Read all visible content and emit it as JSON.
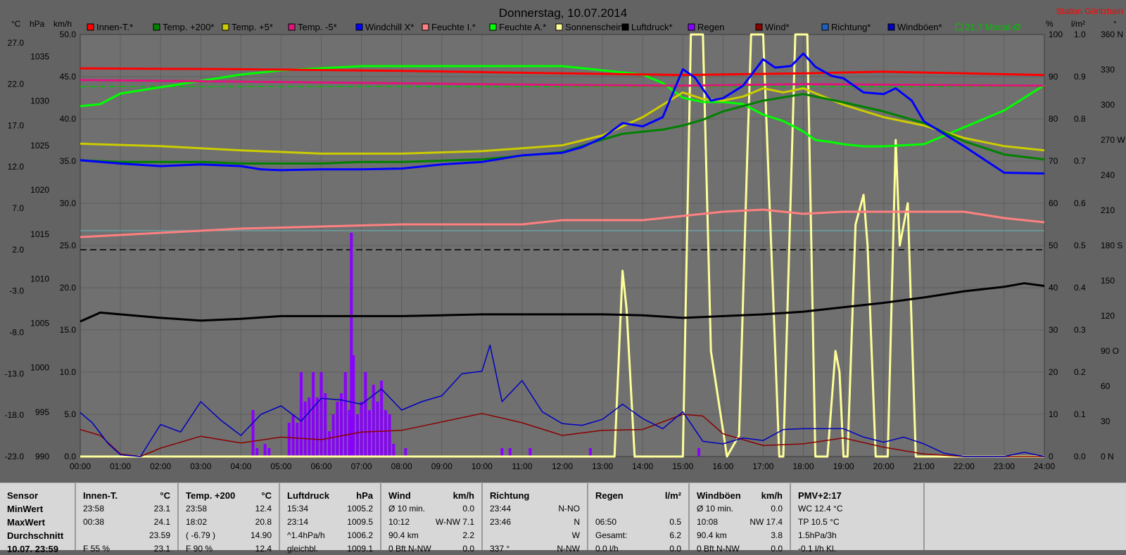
{
  "title": "Donnerstag, 10.07.2014",
  "station": "Station Göritzhain",
  "legend": [
    {
      "name": "Innen-T.*",
      "color": "#ff0000"
    },
    {
      "name": "Temp. +200*",
      "color": "#008000"
    },
    {
      "name": "Temp. +5*",
      "color": "#cccc00"
    },
    {
      "name": "Temp. -5*",
      "color": "#e0157b"
    },
    {
      "name": "Windchill X*",
      "color": "#0000ff"
    },
    {
      "name": "Feuchte I.*",
      "color": "#ff8080"
    },
    {
      "name": "Feuchte A.*",
      "color": "#00ff00"
    },
    {
      "name": "Sonnenschein",
      "color": "#ffff99"
    },
    {
      "name": "Luftdruck*",
      "color": "#000000"
    },
    {
      "name": "Regen",
      "color": "#8a00ff"
    },
    {
      "name": "Wind*",
      "color": "#8b0000"
    },
    {
      "name": "Richtung*",
      "color": "#1f5fbf"
    },
    {
      "name": "Windböen*",
      "color": "#0000c0"
    },
    {
      "name": "21.7 Monat-Ø",
      "color": "#00c000"
    }
  ],
  "axis_units": {
    "temp": "°C",
    "pressure": "hPa",
    "wind": "km/h",
    "humidity": "%",
    "rain": "l/m²",
    "dir": "°"
  },
  "chart_data": {
    "type": "line",
    "x_label": "time",
    "x_ticks": [
      "00:00",
      "01:00",
      "02:00",
      "03:00",
      "04:00",
      "05:00",
      "06:00",
      "07:00",
      "08:00",
      "09:00",
      "10:00",
      "11:00",
      "12:00",
      "13:00",
      "14:00",
      "15:00",
      "16:00",
      "17:00",
      "18:00",
      "19:00",
      "20:00",
      "21:00",
      "22:00",
      "23:00",
      "24:00"
    ],
    "axes": {
      "temp": {
        "ticks": [
          "27.0",
          "22.0",
          "17.0",
          "12.0",
          "7.0",
          "2.0",
          "-3.0",
          "-8.0",
          "-13.0",
          "-18.0",
          "-23.0"
        ],
        "range": [
          -23,
          28
        ]
      },
      "pressure": {
        "ticks": [
          "1035",
          "1030",
          "1025",
          "1020",
          "1015",
          "1010",
          "1005",
          "1000",
          "995",
          "990"
        ],
        "range": [
          990,
          1037.5
        ]
      },
      "wind": {
        "ticks": [
          "50.0",
          "45.0",
          "40.0",
          "35.0",
          "30.0",
          "25.0",
          "20.0",
          "15.0",
          "10.0",
          "5.0",
          "0.0"
        ],
        "range": [
          0,
          50
        ]
      },
      "humidity": {
        "ticks": [
          "100",
          "90",
          "80",
          "70",
          "60",
          "50",
          "40",
          "30",
          "20",
          "10",
          "0"
        ],
        "range": [
          0,
          100
        ]
      },
      "rain": {
        "ticks": [
          "1.0",
          "0.9",
          "0.8",
          "0.7",
          "0.6",
          "0.5",
          "0.4",
          "0.3",
          "0.2",
          "0.1",
          "0.0"
        ],
        "range": [
          0,
          1
        ]
      },
      "dir": {
        "ticks": [
          "360 N",
          "330",
          "300",
          "270 W",
          "240",
          "210",
          "180 S",
          "150",
          "120",
          "90 O",
          "60",
          "30",
          "0 N"
        ],
        "range": [
          0,
          360
        ]
      }
    },
    "grid": true,
    "series": [
      {
        "name": "Innen-T.*",
        "axis": "temp",
        "color": "#ff0000",
        "x": [
          0,
          4,
          8,
          12,
          15,
          18,
          20,
          22,
          24
        ],
        "y": [
          23.9,
          23.8,
          23.6,
          23.3,
          23.1,
          23.3,
          23.5,
          23.3,
          23.1
        ]
      },
      {
        "name": "Temp. +200*",
        "axis": "temp",
        "color": "#008000",
        "x": [
          0,
          1,
          3,
          4,
          5,
          6,
          7,
          8,
          10,
          12,
          12.8,
          13.5,
          14.5,
          15,
          15.5,
          16,
          17,
          18,
          19,
          20,
          21,
          22,
          23,
          24
        ],
        "y": [
          12.8,
          12.6,
          12.6,
          12.4,
          12.4,
          12.4,
          12.6,
          12.6,
          12.9,
          13.8,
          15,
          16,
          16.5,
          17,
          17.7,
          18.7,
          20,
          20.8,
          19.8,
          18.7,
          17.3,
          15.1,
          13.5,
          12.9
        ]
      },
      {
        "name": "Temp. +5*",
        "axis": "temp",
        "color": "#cccc00",
        "x": [
          0,
          2,
          4,
          6,
          8,
          10,
          12,
          13,
          14,
          15,
          15.5,
          16,
          16.5,
          17,
          17.5,
          18,
          19,
          20,
          21,
          22,
          23,
          24
        ],
        "y": [
          14.8,
          14.5,
          14,
          13.6,
          13.6,
          13.9,
          14.6,
          15.8,
          18,
          21,
          20.2,
          20,
          20.5,
          21.5,
          21,
          21.5,
          19.5,
          18,
          17,
          15.5,
          14.5,
          14
        ]
      },
      {
        "name": "Temp. -5*",
        "axis": "temp",
        "color": "#e0157b",
        "x": [
          0,
          6,
          12,
          15,
          18,
          21,
          24
        ],
        "y": [
          22.5,
          22.2,
          21.9,
          21.8,
          22,
          21.9,
          21.8
        ]
      },
      {
        "name": "Windchill X*",
        "axis": "temp",
        "color": "#0000ff",
        "x": [
          0,
          1,
          2,
          3,
          4,
          4.5,
          5,
          6,
          7,
          8,
          9,
          10,
          11,
          12,
          12.5,
          13,
          13.5,
          14,
          14.5,
          15,
          15.3,
          15.7,
          16,
          16.5,
          17,
          17.3,
          17.7,
          18,
          18.3,
          18.7,
          19,
          19.5,
          20,
          20.3,
          20.7,
          21,
          22,
          23,
          24
        ],
        "y": [
          12.8,
          12.4,
          12.1,
          12.3,
          12.1,
          11.7,
          11.6,
          11.7,
          11.7,
          11.8,
          12.3,
          12.6,
          13.4,
          13.7,
          14.4,
          15.5,
          17.3,
          16.9,
          18,
          23.8,
          22.8,
          20,
          20.3,
          21.8,
          25,
          24,
          24.2,
          25.7,
          24.1,
          23,
          22.7,
          21,
          20.8,
          21.5,
          20,
          17.5,
          14.5,
          11.3,
          11.2
        ]
      },
      {
        "name": "Feuchte I.*",
        "axis": "humidity",
        "color": "#ff8080",
        "x": [
          0,
          2,
          4,
          6,
          8,
          11,
          12,
          14,
          15,
          16,
          17,
          18,
          19,
          20,
          21,
          22,
          23,
          24
        ],
        "y": [
          52,
          53,
          54,
          54.5,
          55,
          55,
          56,
          56,
          57,
          58,
          58.5,
          57.5,
          58,
          58,
          58,
          58,
          56.5,
          55.5
        ]
      },
      {
        "name": "Feuchte A.*",
        "axis": "humidity",
        "color": "#00ff00",
        "x": [
          0,
          0.5,
          1,
          2,
          3,
          4,
          5,
          6,
          7,
          8,
          9,
          10,
          11,
          12,
          13,
          14,
          14.5,
          15,
          15.5,
          16,
          16.5,
          17,
          17.5,
          18,
          18.3,
          18.7,
          19,
          19.5,
          20,
          21,
          22,
          23,
          24
        ],
        "y": [
          83,
          83.5,
          86,
          87.5,
          89,
          90.5,
          91.5,
          92,
          92.5,
          92.5,
          92.5,
          92.5,
          92.5,
          92.5,
          91.5,
          90.5,
          88.5,
          85,
          84,
          84,
          83.5,
          81,
          79.5,
          77,
          75,
          74.5,
          74,
          73.5,
          73.5,
          74,
          78,
          82,
          88
        ]
      },
      {
        "name": "Luftdruck*",
        "axis": "pressure",
        "color": "#000000",
        "x": [
          0,
          0.5,
          1,
          2,
          3,
          4,
          5,
          6,
          7,
          8,
          9,
          10,
          11,
          12,
          13,
          14,
          15,
          16,
          17,
          18,
          19,
          20,
          21,
          22,
          23,
          23.5,
          24
        ],
        "y": [
          1005.2,
          1006.2,
          1006,
          1005.6,
          1005.3,
          1005.5,
          1005.8,
          1005.8,
          1005.8,
          1005.8,
          1005.9,
          1006,
          1006,
          1006,
          1006,
          1005.9,
          1005.6,
          1005.8,
          1006,
          1006.3,
          1006.8,
          1007.3,
          1007.9,
          1008.6,
          1009.1,
          1009.5,
          1009.2
        ]
      },
      {
        "name": "Sonnenschein",
        "axis": "humidity",
        "color": "#ffff99",
        "x": [
          0,
          13.3,
          13.5,
          13.6,
          13.8,
          14,
          15,
          15.2,
          15.3,
          15.5,
          15.7,
          16.1,
          16.4,
          16.6,
          16.7,
          17,
          17.2,
          17.4,
          17.5,
          17.8,
          18.1,
          18.3,
          18.6,
          18.8,
          18.9,
          19,
          19.1,
          19.3,
          19.5,
          19.6,
          19.8,
          20.1,
          20.3,
          20.4,
          20.6,
          20.8,
          21.4,
          24
        ],
        "y": [
          0,
          0,
          44,
          35,
          0,
          0,
          0,
          100,
          100,
          100,
          25,
          0,
          5,
          70,
          100,
          100,
          50,
          0,
          0,
          100,
          100,
          0,
          0,
          25,
          20,
          0,
          0,
          55,
          62,
          50,
          0,
          0,
          75,
          50,
          60,
          0,
          0,
          0
        ]
      },
      {
        "name": "Wind*",
        "axis": "wind",
        "color": "#8b0000",
        "x": [
          0,
          0.5,
          1,
          1.5,
          2,
          3,
          4,
          5,
          6,
          7,
          8,
          9,
          10,
          11,
          12,
          13,
          14,
          15,
          15.5,
          16,
          17,
          18,
          19,
          20,
          21,
          22,
          23,
          24
        ],
        "y": [
          3.2,
          2.5,
          0.3,
          0,
          1,
          2.4,
          1.6,
          2.3,
          2,
          2.9,
          3.1,
          4.1,
          5.1,
          4,
          2.5,
          3.1,
          3.2,
          5,
          4.8,
          2.7,
          1.3,
          1.5,
          2.2,
          1.1,
          0.3,
          0,
          0,
          0
        ]
      },
      {
        "name": "Windböen*",
        "axis": "wind",
        "color": "#0000c0",
        "x": [
          0,
          0.3,
          0.7,
          1,
          1.5,
          2,
          2.5,
          3,
          3.5,
          4,
          4.5,
          5,
          5.5,
          6,
          6.5,
          7,
          7.5,
          8,
          8.5,
          9,
          9.5,
          10,
          10.2,
          10.5,
          11,
          11.5,
          12,
          12.5,
          13,
          13.5,
          14,
          14.5,
          15,
          15.5,
          16,
          16.5,
          17,
          17.5,
          18,
          18.5,
          19,
          19.5,
          20,
          20.5,
          21,
          21.5,
          22,
          23,
          23.5,
          24
        ],
        "y": [
          5.2,
          4,
          1.5,
          0.2,
          0,
          3.8,
          2.9,
          6.5,
          4.3,
          2.5,
          5,
          6,
          4.2,
          6.9,
          6.7,
          6.2,
          8,
          5.5,
          6.5,
          7.2,
          9.8,
          10.1,
          13.2,
          6.5,
          9,
          5.3,
          3.9,
          3.7,
          4.4,
          6.2,
          4.5,
          3.3,
          5.3,
          1.8,
          1.5,
          2.2,
          1.9,
          3.2,
          3.3,
          3.3,
          3.3,
          2.3,
          1.7,
          2.3,
          1.5,
          0.4,
          0,
          0,
          0.5,
          0
        ]
      }
    ],
    "rain_bars": {
      "axis": "rain",
      "color": "#8a00ff",
      "x": [
        4.3,
        4.4,
        4.6,
        4.7,
        5.2,
        5.3,
        5.4,
        5.5,
        5.6,
        5.7,
        5.8,
        5.9,
        6.0,
        6.1,
        6.2,
        6.3,
        6.4,
        6.5,
        6.6,
        6.7,
        6.75,
        6.8,
        6.9,
        7.0,
        7.1,
        7.2,
        7.3,
        7.4,
        7.5,
        7.6,
        7.7,
        7.8,
        8.1,
        10.5,
        10.7,
        11.2,
        12.7,
        15.4
      ],
      "y": [
        0.11,
        0.02,
        0.03,
        0.02,
        0.08,
        0.1,
        0.08,
        0.2,
        0.13,
        0.14,
        0.2,
        0.14,
        0.2,
        0.15,
        0.06,
        0.1,
        0.13,
        0.15,
        0.2,
        0.11,
        0.53,
        0.24,
        0.1,
        0.13,
        0.2,
        0.11,
        0.17,
        0.13,
        0.18,
        0.11,
        0.1,
        0.03,
        0.02,
        0.02,
        0.02,
        0.02,
        0.02,
        0.02
      ]
    },
    "reference_lines": [
      {
        "name": "21.7 Monat-Ø",
        "axis": "temp",
        "value": 21.7,
        "color": "#00c000",
        "dash": true
      },
      {
        "axis": "rain",
        "value": 0.49,
        "color": "#000000",
        "dash": true
      },
      {
        "axis": "temp",
        "value": 4.3,
        "color": "#6aa0a0",
        "dash": false
      }
    ]
  },
  "stats": {
    "row_labels": [
      "Sensor",
      "MinWert",
      "MaxWert",
      "Durchschnitt",
      "10.07. 23:59"
    ],
    "sections": [
      {
        "title": "Innen-T.",
        "unit": "°C",
        "min": [
          "23:58",
          "23.1"
        ],
        "max": [
          "00:38",
          "24.1"
        ],
        "avg": [
          "",
          "23.59"
        ],
        "last": [
          "F 55 %",
          "23.1"
        ]
      },
      {
        "title": "Temp. +200",
        "unit": "°C",
        "min": [
          "23:58",
          "12.4"
        ],
        "max": [
          "18:02",
          "20.8"
        ],
        "avg": [
          "( -6.79 )",
          "14.90"
        ],
        "last": [
          "F 90 %",
          "12.4"
        ]
      },
      {
        "title": "Luftdruck",
        "unit": "hPa",
        "min": [
          "15:34",
          "1005.2"
        ],
        "max": [
          "23:14",
          "1009.5"
        ],
        "avg": [
          "^1.4hPa/h",
          "1006.2"
        ],
        "last": [
          "gleichbl.",
          "1009.1"
        ]
      },
      {
        "title": "Wind",
        "unit": "km/h",
        "min": [
          "Ø 10 min.",
          "0.0"
        ],
        "max": [
          "10:12",
          "W-NW 7.1"
        ],
        "avg": [
          "90.4 km",
          "2.2"
        ],
        "last": [
          "0 Bft  N-NW",
          "0.0"
        ]
      },
      {
        "title": "Richtung",
        "unit": "",
        "min": [
          "23:44",
          "N-NO"
        ],
        "max": [
          "23:46",
          "N"
        ],
        "avg": [
          "",
          "W"
        ],
        "last": [
          "337 °",
          "N-NW"
        ]
      },
      {
        "title": "Regen",
        "unit": "l/m²",
        "min": [
          "",
          ""
        ],
        "max": [
          "06:50",
          "0.5"
        ],
        "avg": [
          "Gesamt:",
          "6.2"
        ],
        "last": [
          "0.0 l/h",
          "0.0"
        ]
      },
      {
        "title": "Windböen",
        "unit": "km/h",
        "min": [
          "Ø 10 min.",
          "0.0"
        ],
        "max": [
          "10:08",
          "NW 17.4"
        ],
        "avg": [
          "90.4 km",
          "3.8"
        ],
        "last": [
          "0 Bft  N-NW",
          "0.0"
        ]
      },
      {
        "title": "PMV+2:17",
        "unit": "",
        "min": [
          "WC 12.4 °C",
          ""
        ],
        "max": [
          "TP 10.5 °C",
          ""
        ],
        "avg": [
          "1.5hPa/3h",
          ""
        ],
        "last": [
          "-0.1 l/h  Kl.",
          ""
        ]
      }
    ]
  }
}
